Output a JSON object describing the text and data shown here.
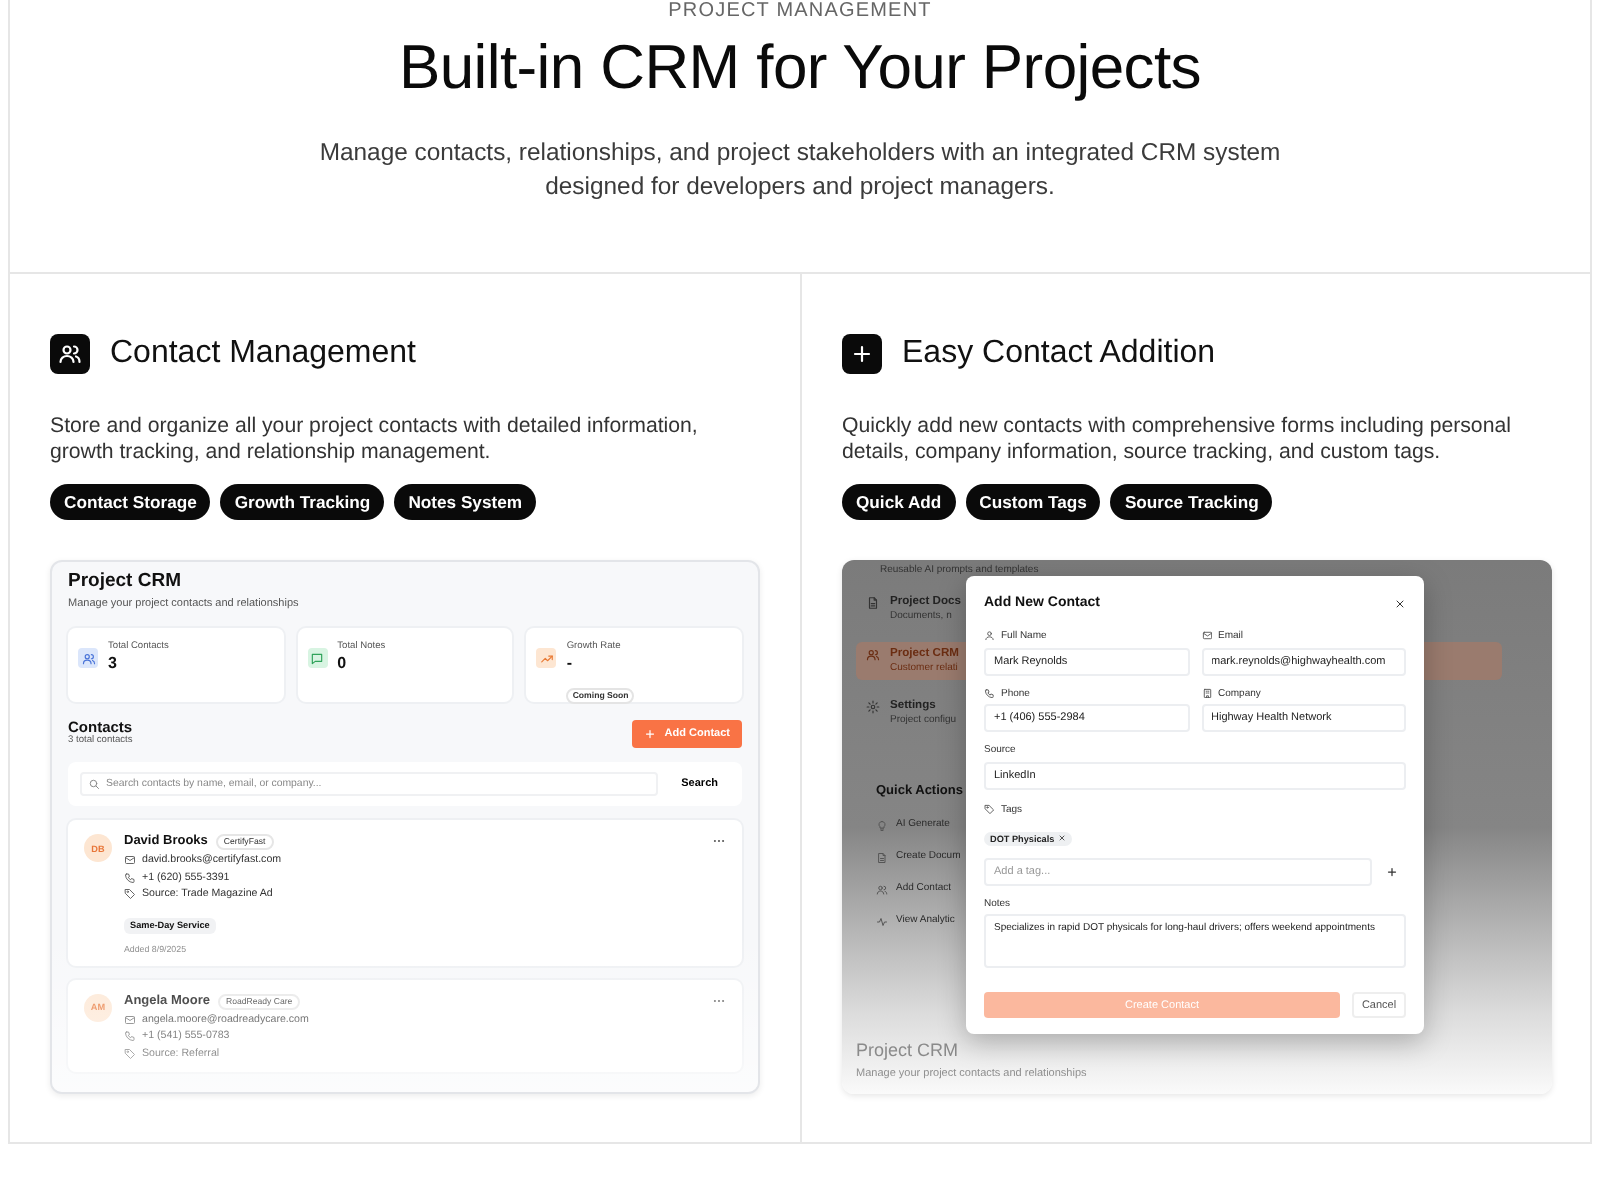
{
  "header": {
    "eyebrow": "PROJECT MANAGEMENT",
    "title": "Built-in CRM for Your Projects",
    "subtitle": "Manage contacts, relationships, and project stakeholders with an integrated CRM system designed for developers and project managers."
  },
  "features": [
    {
      "kind": "contacts",
      "heading": "Contact Management",
      "description": "Store and organize all your project contacts with detailed information, growth tracking, and relationship management.",
      "chips": [
        "Contact Storage",
        "Growth Tracking",
        "Notes System"
      ],
      "preview": {
        "title": "Project CRM",
        "subtitle": "Manage your project contacts and relationships",
        "stats": [
          {
            "kind": "contacts",
            "label": "Total Contacts",
            "value": "3"
          },
          {
            "kind": "notes",
            "label": "Total Notes",
            "value": "0"
          },
          {
            "kind": "growth",
            "label": "Growth Rate",
            "value": "-",
            "badge": "Coming Soon"
          }
        ],
        "contacts_heading": "Contacts",
        "contacts_count": "3 total contacts",
        "add_button": "Add Contact",
        "search": {
          "placeholder": "Search contacts by name, email, or company...",
          "button": "Search"
        },
        "contacts": [
          {
            "initials": "DB",
            "name": "David Brooks",
            "company": "CertifyFast",
            "email": "david.brooks@certifyfast.com",
            "phone": "+1 (620) 555-3391",
            "source": "Source: Trade Magazine Ad",
            "tags": [
              "Same-Day Service"
            ],
            "added": "Added 8/9/2025"
          },
          {
            "initials": "AM",
            "name": "Angela Moore",
            "company": "RoadReady Care",
            "email": "angela.moore@roadreadycare.com",
            "phone": "+1 (541) 555-0783",
            "source": "Source: Referral"
          }
        ]
      }
    },
    {
      "kind": "add",
      "heading": "Easy Contact Addition",
      "description": "Quickly add new contacts with comprehensive forms including personal details, company information, source tracking, and custom tags.",
      "chips": [
        "Quick Add",
        "Custom Tags",
        "Source Tracking"
      ],
      "preview": {
        "backdrop": {
          "top_note": "Reusable AI prompts and templates",
          "items": [
            {
              "kind": "docs",
              "title": "Project Docs",
              "subtitle": "Documents, n",
              "selected": false
            },
            {
              "kind": "crm",
              "title": "Project CRM",
              "subtitle": "Customer relati",
              "selected": true
            },
            {
              "kind": "settings",
              "title": "Settings",
              "subtitle": "Project configu",
              "selected": false
            }
          ],
          "quick_actions_heading": "Quick Actions",
          "quick_actions": [
            {
              "kind": "idea",
              "label": "AI Generate"
            },
            {
              "kind": "doc",
              "label": "Create Docum"
            },
            {
              "kind": "people",
              "label": "Add Contact"
            },
            {
              "kind": "pulse",
              "label": "View Analytic"
            }
          ],
          "footer_title": "Project CRM",
          "footer_subtitle": "Manage your project contacts and relationships"
        },
        "modal": {
          "title": "Add New Contact",
          "fields": [
            {
              "kind": "name",
              "label": "Full Name",
              "value": "Mark Reynolds"
            },
            {
              "kind": "email",
              "label": "Email",
              "value": "mark.reynolds@highwayhealth.com"
            },
            {
              "kind": "phone",
              "label": "Phone",
              "value": "+1 (406) 555-2984"
            },
            {
              "kind": "company",
              "label": "Company",
              "value": "Highway Health Network"
            },
            {
              "kind": "source",
              "label": "Source",
              "value": "LinkedIn"
            }
          ],
          "tags_label": "Tags",
          "tags": [
            "DOT Physicals"
          ],
          "tag_input": {
            "placeholder": "Add a tag..."
          },
          "notes": {
            "label": "Notes",
            "value": "Specializes in rapid DOT physicals for long-haul drivers; offers weekend appointments"
          },
          "submit": "Create Contact",
          "cancel": "Cancel"
        }
      }
    }
  ]
}
